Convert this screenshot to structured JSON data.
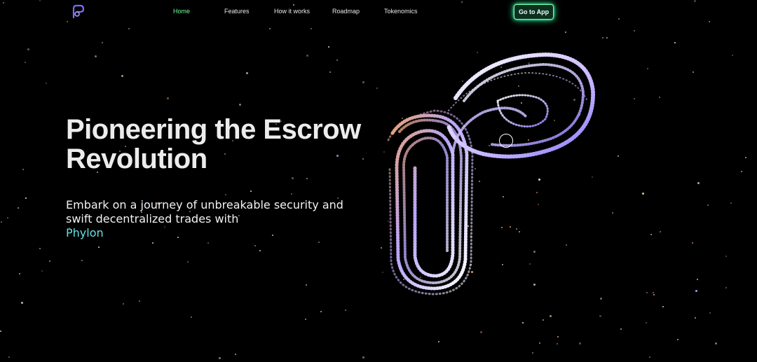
{
  "nav": {
    "logo_icon": "phylon-logo-icon",
    "items": [
      {
        "label": "Home",
        "active": true
      },
      {
        "label": "Features",
        "active": false
      },
      {
        "label": "How it works",
        "active": false
      },
      {
        "label": "Roadmap",
        "active": false
      },
      {
        "label": "Tokenomics",
        "active": false
      }
    ],
    "cta_label": "Go to App"
  },
  "hero": {
    "title_line1": "Pioneering the Escrow",
    "title_line2": "Revolution",
    "subtitle_line1": "Embark on a journey of unbreakable security and",
    "subtitle_line2_prefix": "swift decentralized trades with ",
    "subtitle_brand": "Phylon"
  },
  "colors": {
    "background": "#000000",
    "accent_green": "#6dff9d",
    "brand_cyan": "#64e0e4",
    "particle_purple": "#b8a6ff",
    "particle_orange": "#e8a070",
    "particle_white": "#ffffff"
  },
  "graphic": {
    "name": "particle-infinity-logo",
    "cursor_icon": "cursor-ring-icon"
  }
}
